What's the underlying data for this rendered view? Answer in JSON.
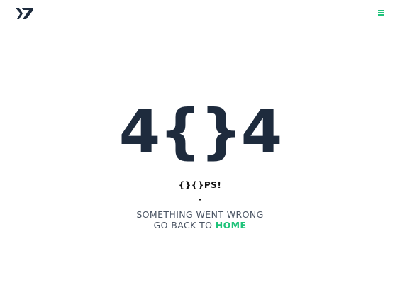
{
  "brand": {
    "logo_icon": "zenbit-logo-icon",
    "color": "#1e2b3d"
  },
  "header": {
    "menu_icon": "hamburger-menu-icon",
    "accent_color": "#1fc37a"
  },
  "error": {
    "code": "4{}4",
    "oops": "{}{}PS!",
    "separator": "-",
    "message": "SOMETHING WENT WRONG",
    "go_back_prefix": "GO BACK TO",
    "home_link": "HOME"
  }
}
